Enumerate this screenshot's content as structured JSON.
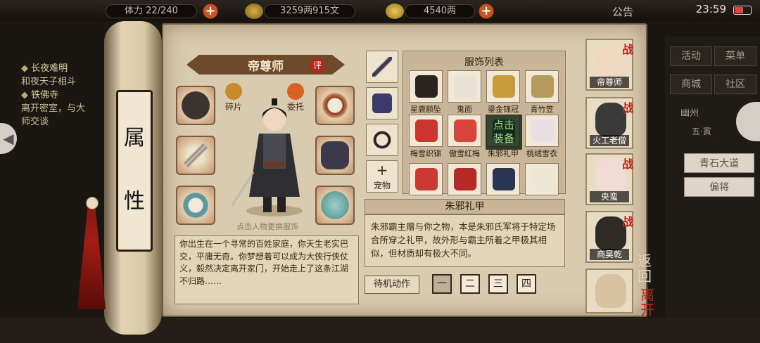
{
  "topbar": {
    "stamina": "22/240",
    "stamina_prefix": "体力",
    "silver": "3259两915文",
    "gold": "4540两",
    "notice": "公告",
    "clock": "23:59"
  },
  "quest": {
    "items": [
      "长夜难明",
      "铁佛寺"
    ],
    "lines": [
      "和夜天子相斗",
      "离开密室，与大",
      "师交谈"
    ]
  },
  "right_panel": {
    "buttons": [
      "活动",
      "菜单",
      "商城",
      "社区"
    ],
    "location": "幽州",
    "weather": "五·寅",
    "links": [
      "青石大道",
      "偏将"
    ]
  },
  "scroll": {
    "title_chars": [
      "属",
      "性"
    ]
  },
  "character": {
    "name": "帝尊师",
    "review_badge": "评",
    "fragment_label": "碎片",
    "entrust_label": "委托",
    "hint": "点击人物更换服饰",
    "bio": "你出生在一个寻常的百姓家庭，你天生老实巴交，平庸无奇。你梦想着可以成为大侠行侠仗义，毅然决定离开家门，开始走上了这条江湖不归路……"
  },
  "items_column": {
    "pet_label": "宠物"
  },
  "clothing": {
    "title": "服饰列表",
    "items": [
      {
        "label": "星鹿额坠",
        "color": "#2a2420"
      },
      {
        "label": "鬼面",
        "color": "#e8e2d6"
      },
      {
        "label": "鎏金锦冠",
        "color": "#c79a3a"
      },
      {
        "label": "青竹笠",
        "color": "#b59a5e"
      },
      {
        "label": "梅雪织锦",
        "color": "#c9372e"
      },
      {
        "label": "傲雪红梅",
        "color": "#d9443a"
      },
      {
        "label": "朱邪礼甲",
        "color": "#2b3042"
      },
      {
        "label": "桃绒雪衣",
        "color": "#e8dfe4"
      },
      {
        "label": "",
        "color": "#c83a32"
      },
      {
        "label": "",
        "color": "#b52a26"
      },
      {
        "label": "",
        "color": "#2a3552"
      },
      {
        "label": "",
        "color": "#ece6d6"
      }
    ],
    "equip_overlay": [
      "点击",
      "装备"
    ]
  },
  "description": {
    "title": "朱邪礼甲",
    "text": "朱邪霸主赠与你之物，本是朱邪氏军将于特定场合所穿之礼甲，故外形与霸主所着之甲极其相似，但材质却有极大不同。"
  },
  "idle": {
    "label": "待机动作",
    "options": [
      "一",
      "二",
      "三",
      "四"
    ],
    "selected": 0
  },
  "companions": [
    {
      "name": "帝尊师",
      "battle": "战"
    },
    {
      "name": "火工老僧",
      "battle": "战"
    },
    {
      "name": "央蛮",
      "battle": "战"
    },
    {
      "name": "商昊乾",
      "battle": "战"
    },
    {
      "name": "",
      "battle": ""
    }
  ],
  "nav": {
    "back": [
      "返",
      "回"
    ],
    "leave": [
      "离",
      "开"
    ]
  }
}
